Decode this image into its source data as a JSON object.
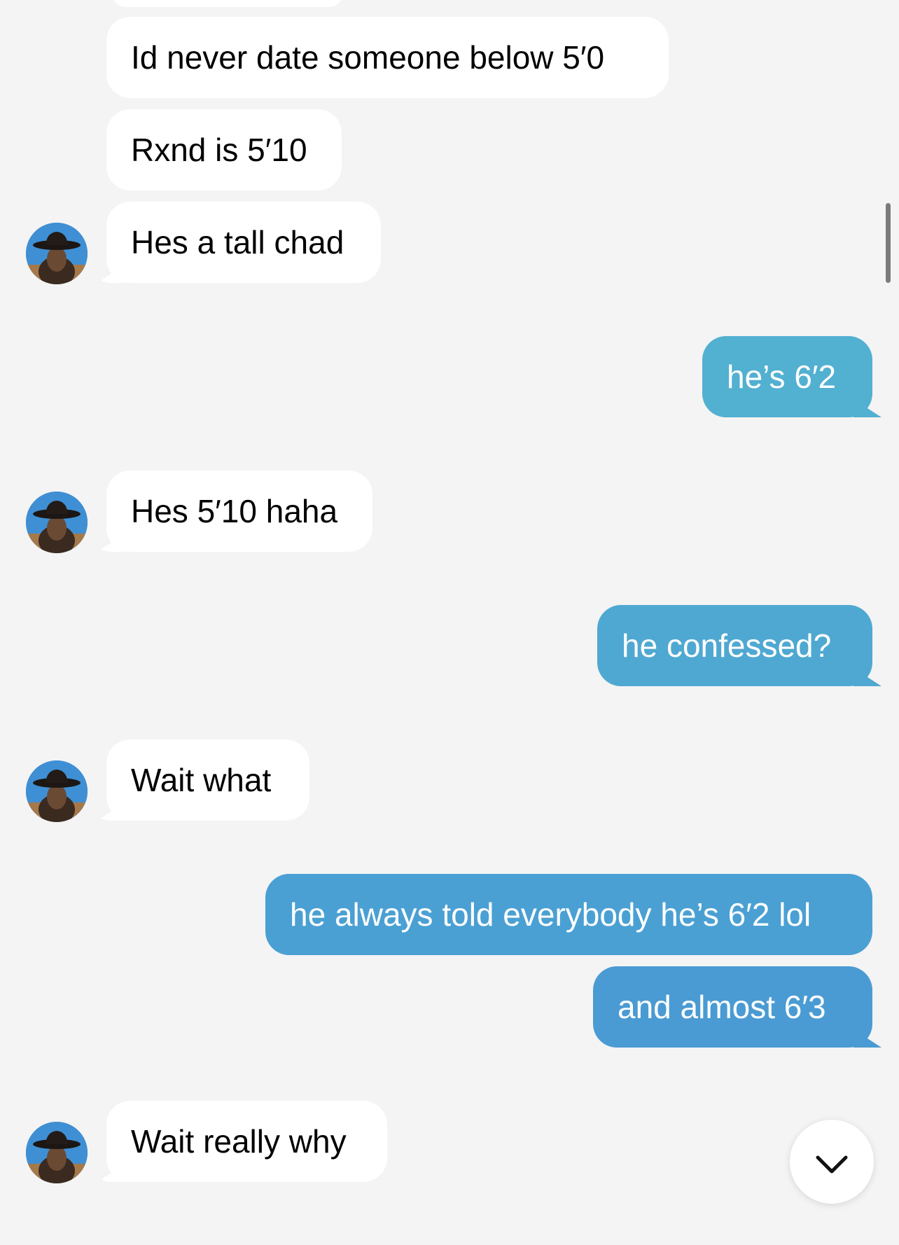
{
  "messages": [
    {
      "text": "Id never date someone below 5′0",
      "direction": "incoming"
    },
    {
      "text": "Rxnd is 5′10",
      "direction": "incoming"
    },
    {
      "text": "Hes a tall chad",
      "direction": "incoming"
    },
    {
      "text": "he’s 6′2",
      "direction": "outgoing"
    },
    {
      "text": "Hes 5′10 haha",
      "direction": "incoming"
    },
    {
      "text": "he confessed?",
      "direction": "outgoing"
    },
    {
      "text": "Wait what",
      "direction": "incoming"
    },
    {
      "text": "he always told everybody he’s 6′2 lol",
      "direction": "outgoing"
    },
    {
      "text": "and almost 6′3",
      "direction": "outgoing"
    },
    {
      "text": "Wait really why",
      "direction": "incoming"
    }
  ],
  "colors": {
    "background": "#f4f4f4",
    "incoming_bubble": "#ffffff",
    "outgoing_bubble": "#4fa8d2"
  },
  "icons": {
    "scroll_down": "chevron-down-icon",
    "avatar": "avatar-cowboy-hat"
  }
}
